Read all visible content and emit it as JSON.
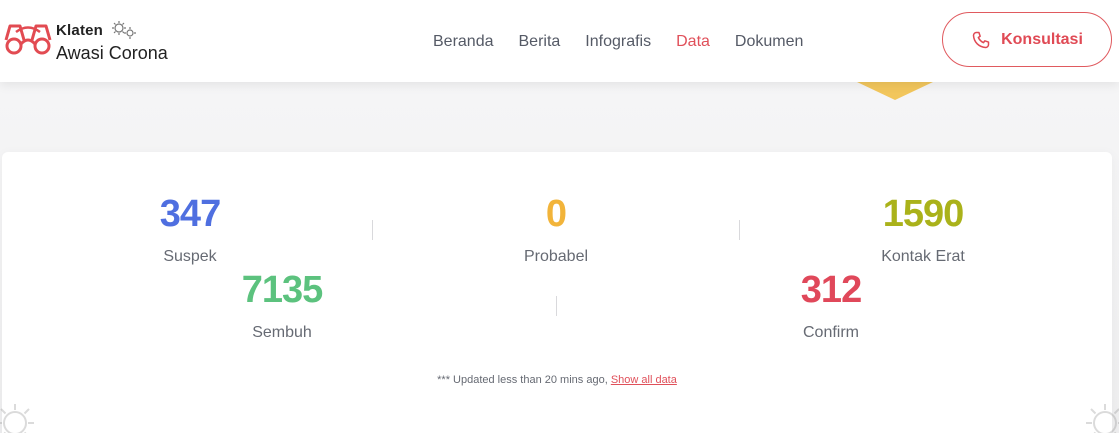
{
  "brand": {
    "line1": "Klaten",
    "line2": "Awasi Corona"
  },
  "nav": {
    "items": [
      {
        "label": "Beranda",
        "active": false
      },
      {
        "label": "Berita",
        "active": false
      },
      {
        "label": "Infografis",
        "active": false
      },
      {
        "label": "Data",
        "active": true
      },
      {
        "label": "Dokumen",
        "active": false
      }
    ]
  },
  "header": {
    "cta_label": "Konsultasi",
    "cta_icon": "phone-icon"
  },
  "stats": {
    "suspek": {
      "value": "347",
      "label": "Suspek",
      "color": "#4f6fe0"
    },
    "probabel": {
      "value": "0",
      "label": "Probabel",
      "color": "#f2b43a"
    },
    "kontak_erat": {
      "value": "1590",
      "label": "Kontak Erat",
      "color": "#aab21a"
    },
    "sembuh": {
      "value": "7135",
      "label": "Sembuh",
      "color": "#5cc27e"
    },
    "confirm": {
      "value": "312",
      "label": "Confirm",
      "color": "#e0485a"
    }
  },
  "update_note": {
    "text": "*** Updated less than 20 mins ago, ",
    "link": "Show all data"
  },
  "colors": {
    "accent": "#e0505a",
    "nav_text": "#555a66"
  }
}
